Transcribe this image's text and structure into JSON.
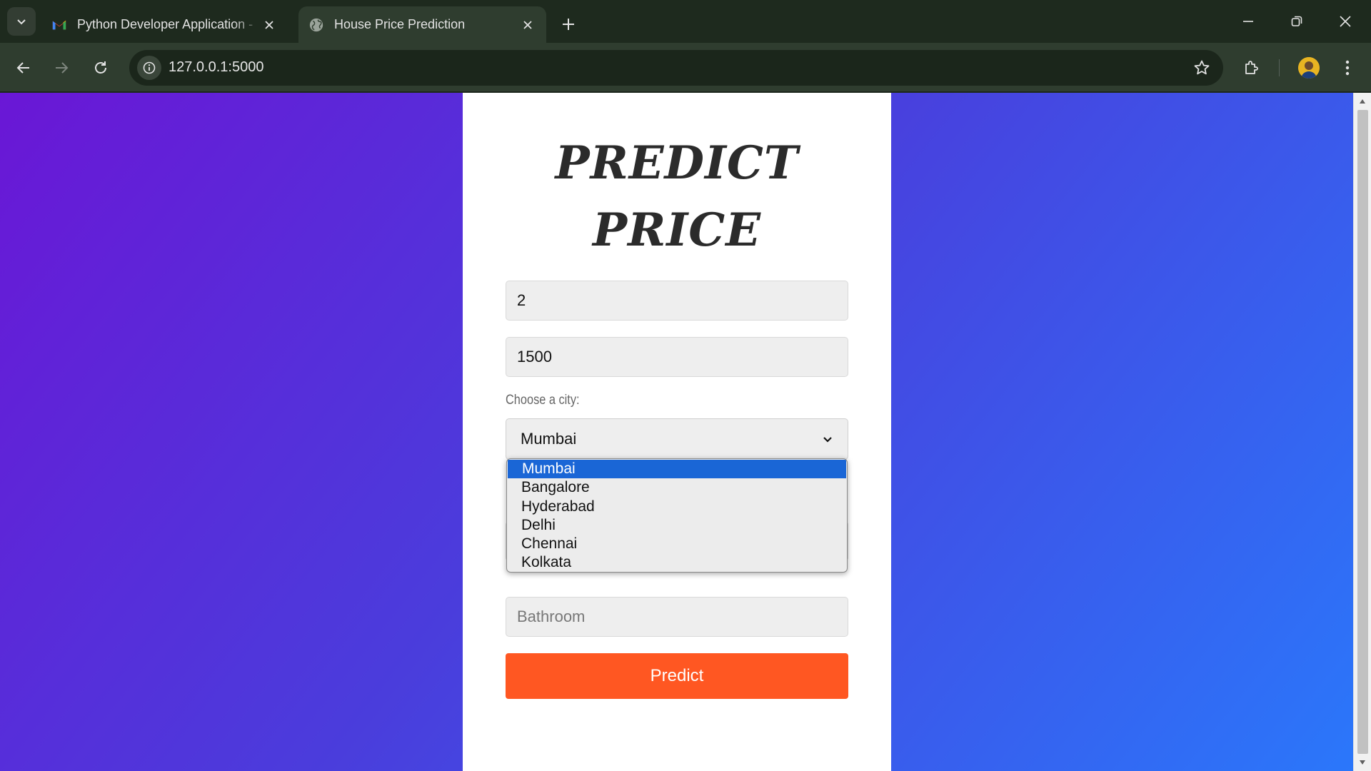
{
  "browser": {
    "tabs": [
      {
        "title": "Python Developer Application -",
        "favicon": "gmail-icon",
        "active": false
      },
      {
        "title": "House Price Prediction",
        "favicon": "globe-icon",
        "active": true
      }
    ],
    "url": "127.0.0.1:5000"
  },
  "page": {
    "heading": "PREDICT PRICE",
    "bhk_value": "2",
    "sqft_value": "1500",
    "city_label": "Choose a city:",
    "city_selected": "Mumbai",
    "bathroom_placeholder": "Bathroom",
    "predict_label": "Predict"
  },
  "dropdown": {
    "options": [
      "Mumbai",
      "Bangalore",
      "Hyderabad",
      "Delhi",
      "Chennai",
      "Kolkata"
    ],
    "highlighted": "Mumbai"
  },
  "colors": {
    "gradient_start": "#6a17d6",
    "gradient_end": "#2a78fb",
    "predict_button": "#ff5722",
    "option_highlight": "#1a66d6",
    "browser_frame": "#2f3d2f"
  }
}
